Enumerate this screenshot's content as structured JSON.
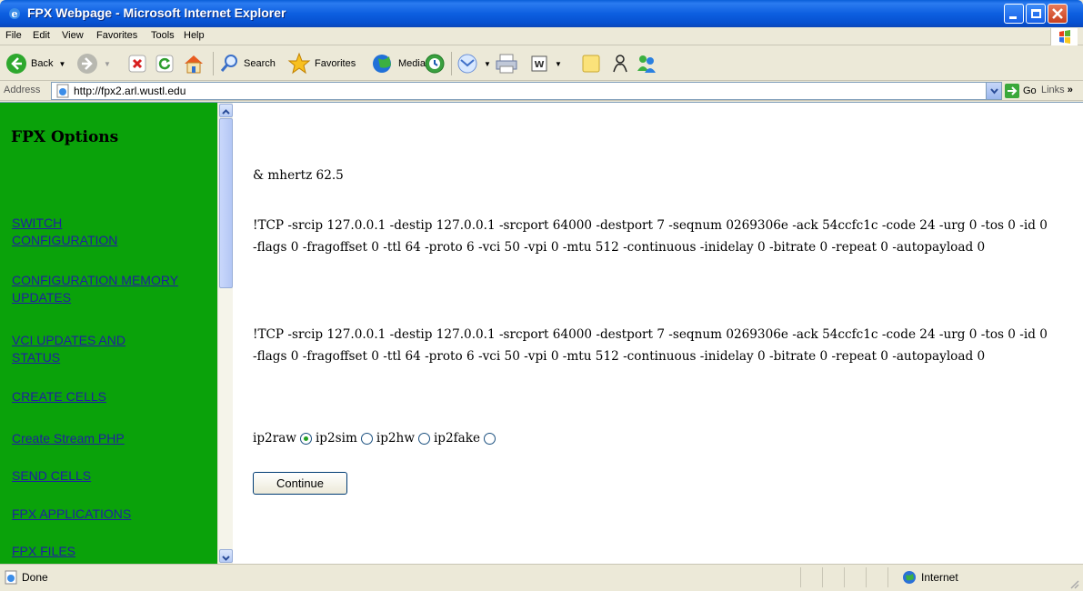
{
  "window": {
    "title": "FPX Webpage - Microsoft Internet Explorer"
  },
  "menu": {
    "items": [
      "File",
      "Edit",
      "View",
      "Favorites",
      "Tools",
      "Help"
    ]
  },
  "toolbar": {
    "back_label": "Back",
    "search_label": "Search",
    "favorites_label": "Favorites",
    "media_label": "Media"
  },
  "address": {
    "label": "Address",
    "url": "http://fpx2.arl.wustl.edu",
    "go_label": "Go",
    "links_label": "Links"
  },
  "sidebar": {
    "title": "FPX Options",
    "links": [
      "SWITCH CONFIGURATION",
      "CONFIGURATION MEMORY UPDATES",
      "VCI UPDATES AND STATUS",
      "CREATE CELLS",
      "Create Stream PHP",
      "SEND CELLS",
      "FPX APPLICATIONS",
      "FPX FILES"
    ]
  },
  "main": {
    "line1": "& mhertz 62.5",
    "tcp1": "!TCP -srcip 127.0.0.1 -destip 127.0.0.1 -srcport 64000 -destport 7 -seqnum 0269306e -ack 54ccfc1c -code 24 -urg 0 -tos 0 -id 0 -flags 0 -fragoffset 0 -ttl 64 -proto 6 -vci 50 -vpi 0 -mtu 512 -continuous -inidelay 0 -bitrate 0 -repeat 0 -autopayload 0",
    "tcp2": "!TCP -srcip 127.0.0.1 -destip 127.0.0.1 -srcport 64000 -destport 7 -seqnum 0269306e -ack 54ccfc1c -code 24 -urg 0 -tos 0 -id 0 -flags 0 -fragoffset 0 -ttl 64 -proto 6 -vci 50 -vpi 0 -mtu 512 -continuous -inidelay 0 -bitrate 0 -repeat 0 -autopayload 0",
    "radios": [
      {
        "label": "ip2raw",
        "checked": true
      },
      {
        "label": "ip2sim",
        "checked": false
      },
      {
        "label": "ip2hw",
        "checked": false
      },
      {
        "label": "ip2fake",
        "checked": false
      }
    ],
    "continue_label": "Continue"
  },
  "status": {
    "text": "Done",
    "zone": "Internet"
  },
  "colors": {
    "sidebar_bg": "#0aa20a",
    "link": "#2020a0",
    "titlebar": "#0d5fe0"
  }
}
